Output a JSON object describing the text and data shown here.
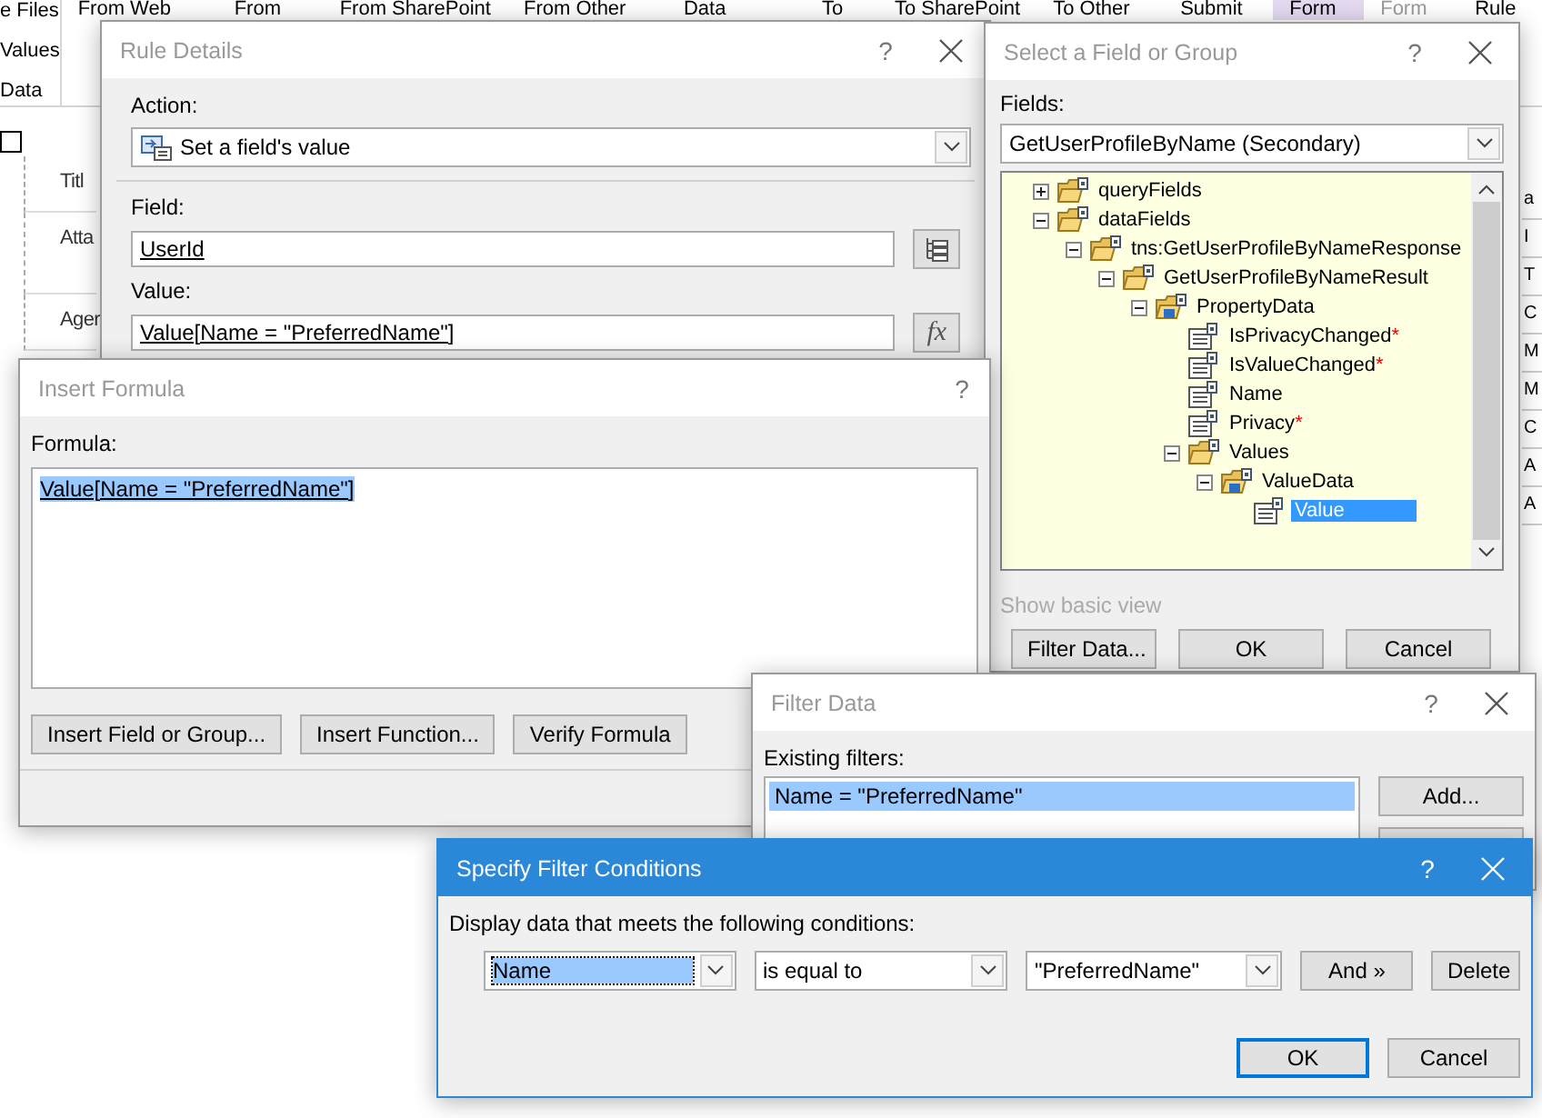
{
  "ribbon": {
    "left_labels": [
      "e Files",
      "Values",
      "Data"
    ],
    "commands": [
      {
        "label": "From Web",
        "selected": false,
        "disabled": false
      },
      {
        "label": "From",
        "selected": false,
        "disabled": false
      },
      {
        "label": "From SharePoint",
        "selected": false,
        "disabled": false
      },
      {
        "label": "From Other",
        "selected": false,
        "disabled": false
      },
      {
        "label": "Data",
        "selected": false,
        "disabled": false
      },
      {
        "label": "To",
        "selected": false,
        "disabled": false
      },
      {
        "label": "To SharePoint",
        "selected": false,
        "disabled": false
      },
      {
        "label": "To Other",
        "selected": false,
        "disabled": false
      },
      {
        "label": "Submit",
        "selected": false,
        "disabled": false
      },
      {
        "label": "Form",
        "selected": true,
        "disabled": false
      },
      {
        "label": "Form",
        "selected": false,
        "disabled": true
      },
      {
        "label": "Rule",
        "selected": false,
        "disabled": false
      }
    ]
  },
  "form": {
    "checked": false,
    "rows": [
      "Titl",
      "Atta",
      "Ager"
    ]
  },
  "right_edge_cells": [
    "a",
    "I",
    "T",
    "C",
    "M",
    "M",
    "C",
    "A",
    "A"
  ],
  "rule_details": {
    "title": "Rule Details",
    "help": "?",
    "closable": true,
    "active": false,
    "action_label": "Action:",
    "action_value": "Set a field's value",
    "field_label": "Field:",
    "field_value": "UserId",
    "value_label": "Value:",
    "value_value": "Value[Name = \"PreferredName\"]",
    "function_button": "fx"
  },
  "select_field": {
    "title": "Select a Field or Group",
    "help": "?",
    "closable": true,
    "active": false,
    "fields_label": "Fields:",
    "source": "GetUserProfileByName (Secondary)",
    "tree": [
      {
        "label": "queryFields",
        "kind": "group",
        "expanded": false,
        "selected": false
      },
      {
        "label": "dataFields",
        "kind": "group",
        "expanded": true,
        "selected": false,
        "children": [
          {
            "label": "tns:GetUserProfileByNameResponse",
            "kind": "group",
            "expanded": true,
            "selected": false,
            "children": [
              {
                "label": "GetUserProfileByNameResult",
                "kind": "group",
                "expanded": true,
                "selected": false,
                "children": [
                  {
                    "label": "PropertyData",
                    "kind": "repeating",
                    "expanded": true,
                    "selected": false,
                    "children": [
                      {
                        "label": "IsPrivacyChanged",
                        "kind": "field",
                        "mark": "*",
                        "selected": false
                      },
                      {
                        "label": "IsValueChanged",
                        "kind": "field",
                        "mark": "*",
                        "selected": false
                      },
                      {
                        "label": "Name",
                        "kind": "field",
                        "selected": false
                      },
                      {
                        "label": "Privacy",
                        "kind": "field",
                        "mark": "*",
                        "selected": false
                      },
                      {
                        "label": "Values",
                        "kind": "group",
                        "expanded": true,
                        "selected": false,
                        "children": [
                          {
                            "label": "ValueData",
                            "kind": "repeating",
                            "expanded": true,
                            "selected": false,
                            "children": [
                              {
                                "label": "Value",
                                "kind": "field",
                                "selected": true
                              }
                            ]
                          }
                        ]
                      }
                    ]
                  }
                ]
              }
            ]
          }
        ]
      }
    ],
    "basic_view_link": "Show basic view",
    "buttons": [
      "Filter Data...",
      "OK",
      "Cancel"
    ]
  },
  "insert_formula": {
    "title": "Insert Formula",
    "help": "?",
    "closable": false,
    "active": false,
    "formula_label": "Formula:",
    "formula": "Value[Name = \"PreferredName\"]",
    "formula_selected": true,
    "buttons": [
      "Insert Field or Group...",
      "Insert Function...",
      "Verify Formula"
    ]
  },
  "filter_data": {
    "title": "Filter Data",
    "help": "?",
    "closable": true,
    "active": false,
    "filters_label": "Existing filters:",
    "filters": [
      {
        "text": "Name = \"PreferredName\"",
        "selected": true
      }
    ],
    "buttons": [
      "Add..."
    ]
  },
  "specify_filter": {
    "title": "Specify Filter Conditions",
    "help": "?",
    "closable": true,
    "active": true,
    "prompt": "Display data that meets the following conditions:",
    "conditions": [
      {
        "field": "Name",
        "field_selected": true,
        "operator": "is equal to",
        "value": "\"PreferredName\"",
        "and_button": "And »",
        "delete_button": "Delete"
      }
    ],
    "buttons": [
      {
        "label": "OK",
        "default": true
      },
      {
        "label": "Cancel",
        "default": false
      }
    ]
  }
}
